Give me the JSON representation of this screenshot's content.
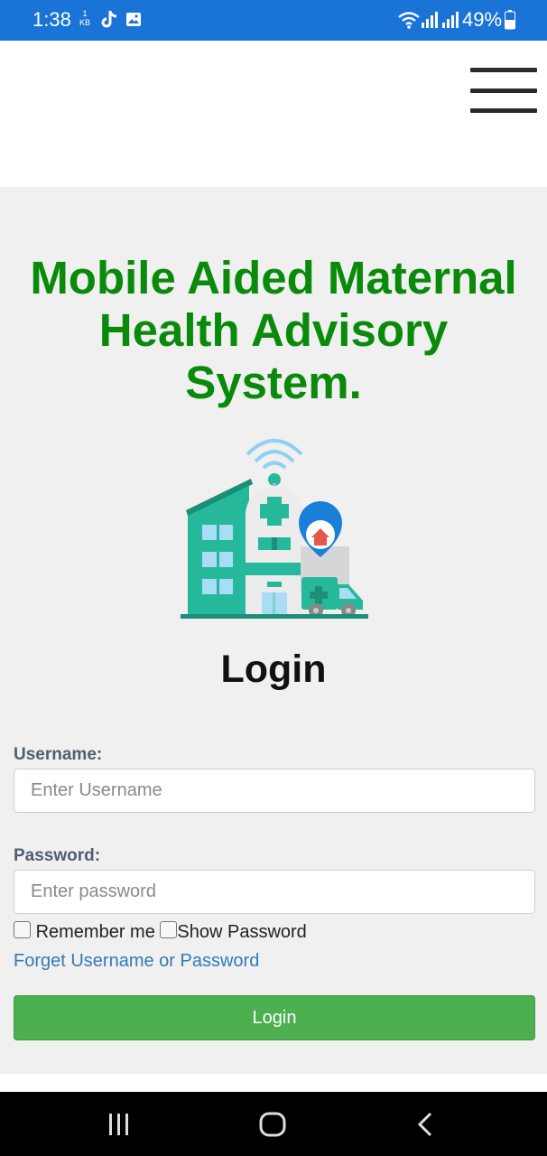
{
  "status_bar": {
    "time": "1:38",
    "kb_top": "1",
    "kb_bottom": "KB",
    "battery": "49%",
    "icons": [
      "tiktok-icon",
      "gallery-icon",
      "wifi-icon",
      "signal-icon",
      "signal-icon",
      "battery-icon"
    ],
    "bg_color": "#1a73d6"
  },
  "header": {
    "menu_icon": "hamburger-menu-icon"
  },
  "main": {
    "title_line1": "Mobile Aided Maternal",
    "title_line2": "Health Advisory",
    "title_line3": "System.",
    "title_color": "#0a8a0a",
    "illustration": "hospital-illustration",
    "login_heading": "Login",
    "username_label": "Username:",
    "username_placeholder": "Enter Username",
    "password_label": "Password:",
    "password_placeholder": "Enter password",
    "remember_label": "Remember me",
    "show_password_label": "Show Password",
    "forgot_link": "Forget Username or Password",
    "login_button": "Login",
    "button_color": "#4caf50",
    "link_color": "#337ab7"
  },
  "nav_bar": {
    "buttons": [
      "recent-apps-icon",
      "home-icon",
      "back-icon"
    ]
  }
}
